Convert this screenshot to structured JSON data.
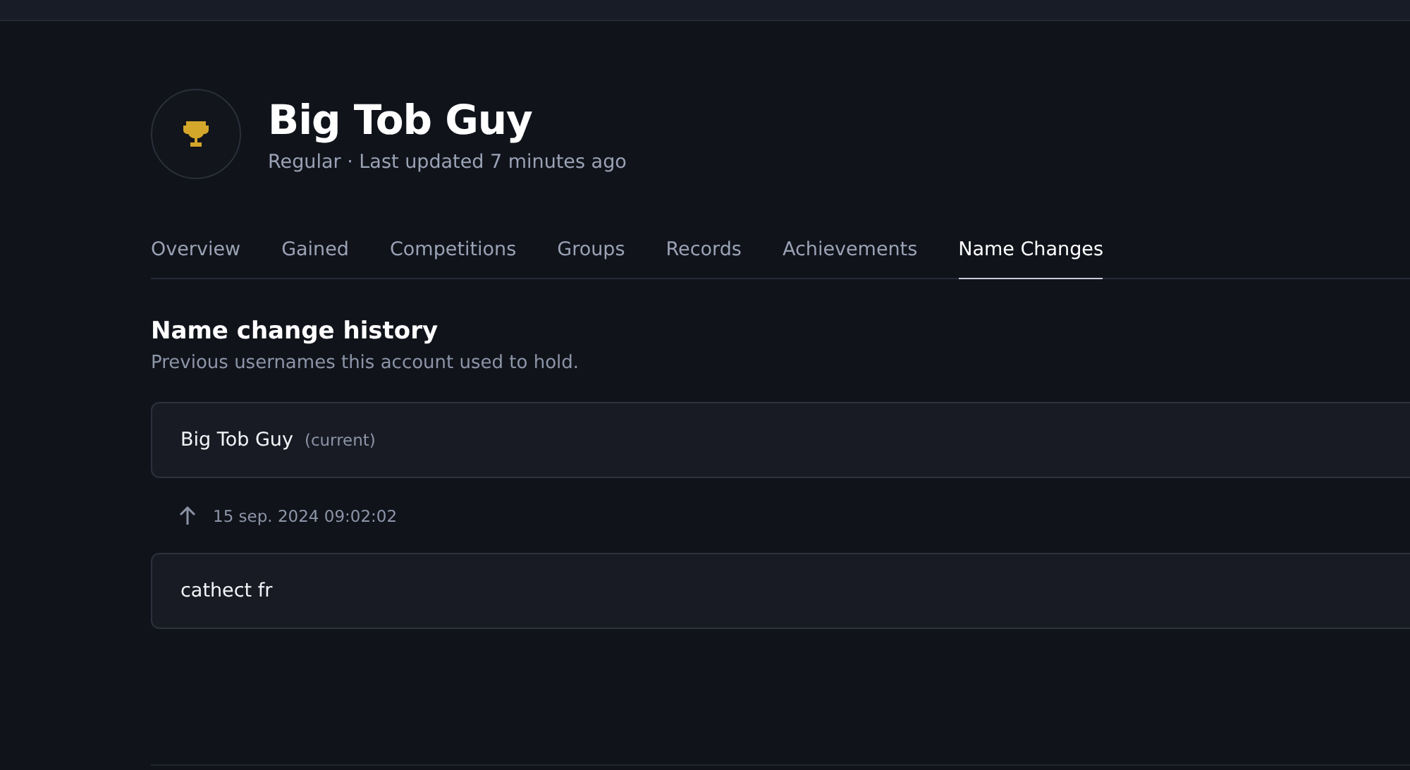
{
  "profile": {
    "name": "Big Tob Guy",
    "subtitle": "Regular · Last updated 7 minutes ago"
  },
  "tabs": [
    {
      "label": "Overview",
      "selected": false
    },
    {
      "label": "Gained",
      "selected": false
    },
    {
      "label": "Competitions",
      "selected": false
    },
    {
      "label": "Groups",
      "selected": false
    },
    {
      "label": "Records",
      "selected": false
    },
    {
      "label": "Achievements",
      "selected": false
    },
    {
      "label": "Name Changes",
      "selected": true
    }
  ],
  "section": {
    "title": "Name change history",
    "description": "Previous usernames this account used to hold."
  },
  "history": [
    {
      "kind": "name",
      "name": "Big Tob Guy",
      "tag": "(current)"
    },
    {
      "kind": "change",
      "date": "15 sep. 2024 09:02:02"
    },
    {
      "kind": "name",
      "name": "cathect fr"
    }
  ]
}
